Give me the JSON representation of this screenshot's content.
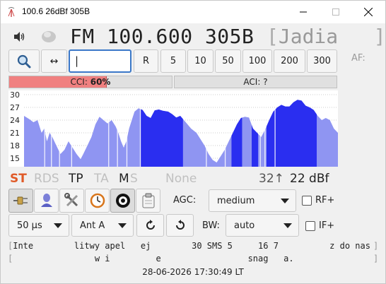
{
  "window": {
    "title": "100.6 26dBf 305B",
    "minimize_icon": "minimize-icon",
    "maximize_icon": "maximize-icon",
    "close_icon": "close-icon"
  },
  "tuner": {
    "band": "FM",
    "frequency": "100.600",
    "pi_code": "305B",
    "ps_open": "[",
    "ps_name": "Jadia",
    "ps_pad": "   ",
    "ps_close": "]"
  },
  "toolbar": {
    "search_icon": "magnifier-icon",
    "scan_icon": "left-right-arrows-icon",
    "scan_label": "↔",
    "freq_input_value": "|",
    "reset_label": "R",
    "step_buttons": [
      "5",
      "10",
      "50",
      "100",
      "200",
      "300"
    ],
    "af_label": "AF:"
  },
  "interference": {
    "cci_label": "CCI:",
    "cci_value": "60%",
    "cci_level": 0.6,
    "aci_label": "ACI: ?"
  },
  "chart_data": {
    "type": "area",
    "yticks": [
      "30",
      "27",
      "24",
      "21",
      "18",
      "15"
    ],
    "ylim": [
      13,
      31
    ],
    "grid": true,
    "colors": {
      "light": "#8f95f2",
      "dark": "#2a2ef0",
      "grid": "#999999"
    }
  },
  "status": {
    "st": "ST",
    "rds": "RDS",
    "tp": "TP",
    "ta": "TA",
    "ms_m": "M",
    "ms_s": "S",
    "pty": "None",
    "sub_value": "32↑",
    "signal": "22 dBf",
    "colors": {
      "st_active": "#e05a28",
      "inactive": "#c0c0c0",
      "active": "#222222"
    }
  },
  "tools": {
    "connect_icon": "plug-icon",
    "person_icon": "user-icon",
    "tools_icon": "wrench-screwdriver-icon",
    "clock_icon": "clock-icon",
    "record_icon": "record-icon",
    "save_icon": "clipboard-icon",
    "agc_label": "AGC:",
    "agc_value": "medium",
    "rf_label": "RF+",
    "deemphasis_value": "50 µs",
    "antenna_value": "Ant A",
    "rotate_cw_icon": "rotate-clockwise-icon",
    "rotate_ccw_icon": "rotate-counterclockwise-icon",
    "bw_label": "BW:",
    "bw_value": "auto",
    "if_label": "IF+"
  },
  "radiotext": {
    "line1_open": "[",
    "line1": "Inte        litwy apel   ej        30 SMS 5     16 7          z do nas",
    "line1_close": "]",
    "line2_open": "[",
    "line2": "                w i         e                 snag   a.",
    "line2_close": "]"
  },
  "clock": "28-06-2026 17:30:49 LT"
}
